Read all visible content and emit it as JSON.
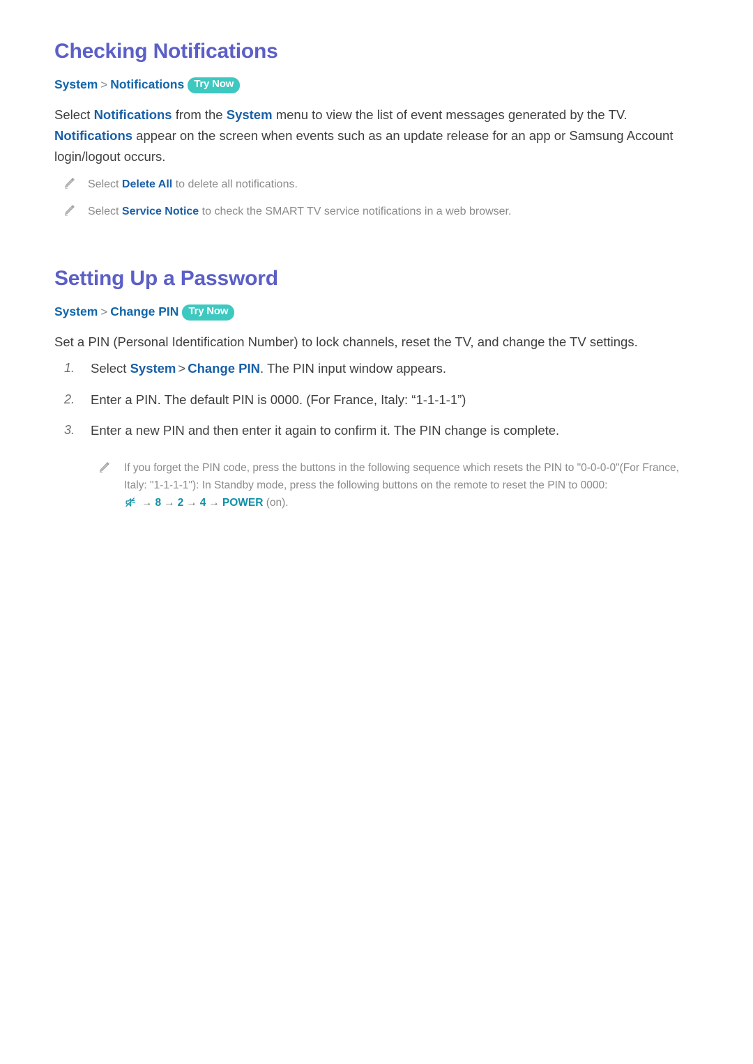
{
  "sections": [
    {
      "title": "Checking Notifications",
      "breadcrumb": {
        "root": "System",
        "separator": ">",
        "leaf": "Notifications",
        "badge": "Try Now"
      },
      "paragraph": {
        "p1": "Select ",
        "link1": "Notifications",
        "p2": " from the ",
        "link2": "System",
        "p3": " menu to view the list of event messages generated by the TV. ",
        "link3": "Notifications",
        "p4": " appear on the screen when events such as an update release for an app or Samsung Account login/logout occurs."
      },
      "notes": [
        {
          "icon": "pencil-icon",
          "pre": "Select ",
          "link": "Delete All",
          "post": " to delete all notifications."
        },
        {
          "icon": "pencil-icon",
          "pre": "Select ",
          "link": "Service Notice",
          "post": " to check the SMART TV service notifications in a web browser."
        }
      ]
    },
    {
      "title": "Setting Up a Password",
      "breadcrumb": {
        "root": "System",
        "separator": ">",
        "leaf": "Change PIN",
        "badge": "Try Now"
      },
      "intro": "Set a PIN (Personal Identification Number) to lock channels, reset the TV, and change the TV settings.",
      "steps": [
        {
          "number": "1.",
          "pre": "Select ",
          "link1": "System",
          "sep": ">",
          "link2": "Change PIN",
          "post": ". The PIN input window appears."
        },
        {
          "number": "2.",
          "text": "Enter a PIN. The default PIN is 0000. (For France, Italy: “1-1-1-1”)"
        },
        {
          "number": "3.",
          "text": "Enter a new PIN and then enter it again to confirm it. The PIN change is complete."
        }
      ],
      "deep_note": {
        "icon": "pencil-icon",
        "text": "If you forget the PIN code, press the buttons in the following sequence which resets the PIN to \"0-0-0-0\"(For France, Italy: \"1-1-1-1\"): In Standby mode, press the following buttons on the remote to reset the PIN to 0000: ",
        "sequence": {
          "mute_icon": "mute-icon",
          "arrow": "→",
          "key1": "8",
          "key2": "2",
          "key3": "4",
          "key4": "POWER"
        },
        "suffix": " (on).",
        "trailing_period": ""
      }
    }
  ],
  "colors": {
    "heading": "#5B5FC7",
    "breadcrumb": "#1166AA",
    "inline_link": "#1A5FA8",
    "badge_bg": "#3DC8C0",
    "badge_text": "#FFFFFF",
    "body_text": "#3F3F3F",
    "note_text": "#8A8A8A",
    "key_teal": "#0F90A8",
    "page_bg": "#FFFFFF"
  }
}
